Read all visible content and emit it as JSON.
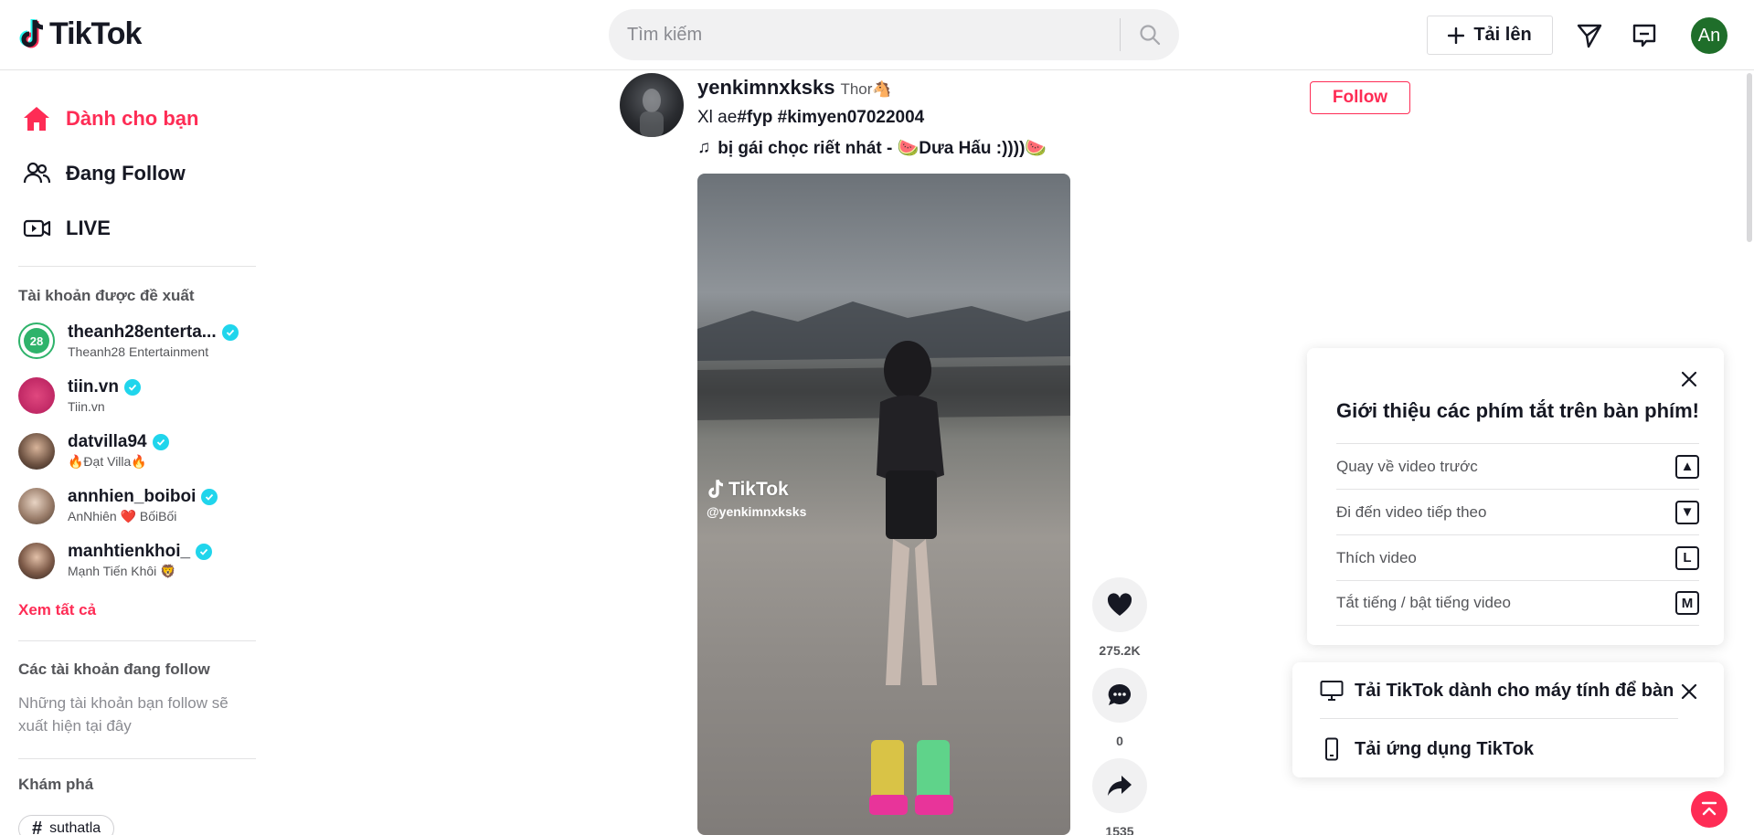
{
  "header": {
    "logo_text": "TikTok",
    "search_placeholder": "Tìm kiếm",
    "upload_label": "Tải lên",
    "avatar_initials": "An"
  },
  "sidebar": {
    "nav": [
      {
        "label": "Dành cho bạn",
        "icon": "home-icon",
        "active": true
      },
      {
        "label": "Đang Follow",
        "icon": "users-icon"
      },
      {
        "label": "LIVE",
        "icon": "live-camera-icon"
      }
    ],
    "suggested_title": "Tài khoản được đề xuất",
    "suggested": [
      {
        "username": "theanh28enterta...",
        "display": "Theanh28 Entertainment",
        "verified": true
      },
      {
        "username": "tiin.vn",
        "display": "Tiin.vn",
        "verified": true
      },
      {
        "username": "datvilla94",
        "display": "🔥Đạt Villa🔥",
        "verified": true
      },
      {
        "username": "annhien_boiboi",
        "display": "AnNhiên ❤️ BốiBối",
        "verified": true
      },
      {
        "username": "manhtienkhoi_",
        "display": "Mạnh Tiến Khôi 🦁",
        "verified": true
      }
    ],
    "see_all": "Xem tất cả",
    "following_title": "Các tài khoản đang follow",
    "following_empty": "Những tài khoản bạn follow sẽ xuất hiện tại đây",
    "discover_title": "Khám phá",
    "discover_tag": "suthatla"
  },
  "post": {
    "username": "yenkimnxksks",
    "nickname": "Thor🐴",
    "caption_text": "Xl ae",
    "caption_tags": "#fyp #kimyen07022004",
    "music": "bị gái chọc riết nhát - 🍉Dưa Hấu :))))🍉",
    "follow_label": "Follow",
    "watermark_brand": "TikTok",
    "watermark_user": "@yenkimnxksks",
    "likes": "275.2K",
    "comments": "0",
    "shares": "1535"
  },
  "shortcuts": {
    "title": "Giới thiệu các phím tắt trên bàn phím!",
    "rows": [
      {
        "label": "Quay về video trước",
        "key": "▲"
      },
      {
        "label": "Đi đến video tiếp theo",
        "key": "▼"
      },
      {
        "label": "Thích video",
        "key": "L"
      },
      {
        "label": "Tắt tiếng / bật tiếng video",
        "key": "M"
      }
    ]
  },
  "download": {
    "desktop": "Tải TikTok dành cho máy tính để bàn",
    "app": "Tải ứng dụng TikTok"
  },
  "colors": {
    "accent": "#fe2c55",
    "verified": "#20d5ec",
    "text": "#161823"
  }
}
